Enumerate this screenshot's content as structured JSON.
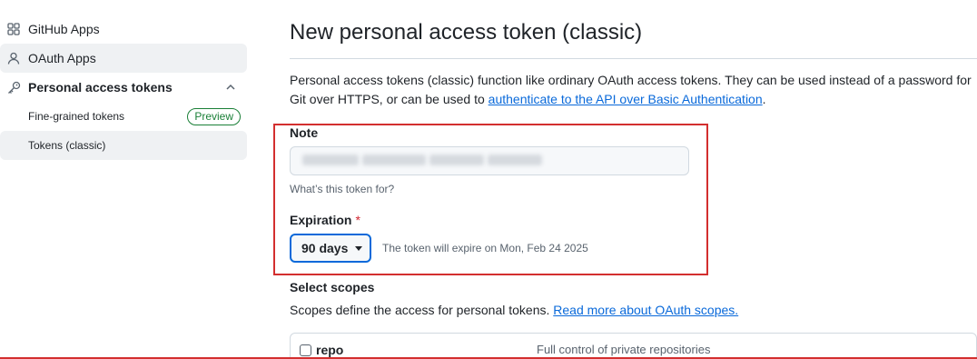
{
  "sidebar": {
    "items": [
      {
        "label": "GitHub Apps",
        "icon": "apps-icon"
      },
      {
        "label": "OAuth Apps",
        "icon": "person-icon"
      },
      {
        "label": "Personal access tokens",
        "icon": "key-icon"
      }
    ],
    "subitems": [
      {
        "label": "Fine-grained tokens",
        "badge": "Preview"
      },
      {
        "label": "Tokens (classic)"
      }
    ]
  },
  "main": {
    "title": "New personal access token (classic)",
    "description": {
      "text_before": "Personal access tokens (classic) function like ordinary OAuth access tokens. They can be used instead of a password for Git over HTTPS, or can be used to ",
      "link": "authenticate to the API over Basic Authentication",
      "text_after": "."
    },
    "note": {
      "label": "Note",
      "value": "",
      "help": "What’s this token for?"
    },
    "expiration": {
      "label": "Expiration",
      "required_mark": "*",
      "selected": "90 days",
      "note": "The token will expire on Mon, Feb 24 2025"
    },
    "scopes": {
      "label": "Select scopes",
      "description": "Scopes define the access for personal tokens. ",
      "link": "Read more about OAuth scopes.",
      "rows": [
        {
          "name": "repo",
          "description": "Full control of private repositories"
        }
      ]
    }
  },
  "colors": {
    "link": "#0969da",
    "success": "#1a7f37",
    "danger": "#d1242f",
    "annotation": "#d32f2f"
  }
}
